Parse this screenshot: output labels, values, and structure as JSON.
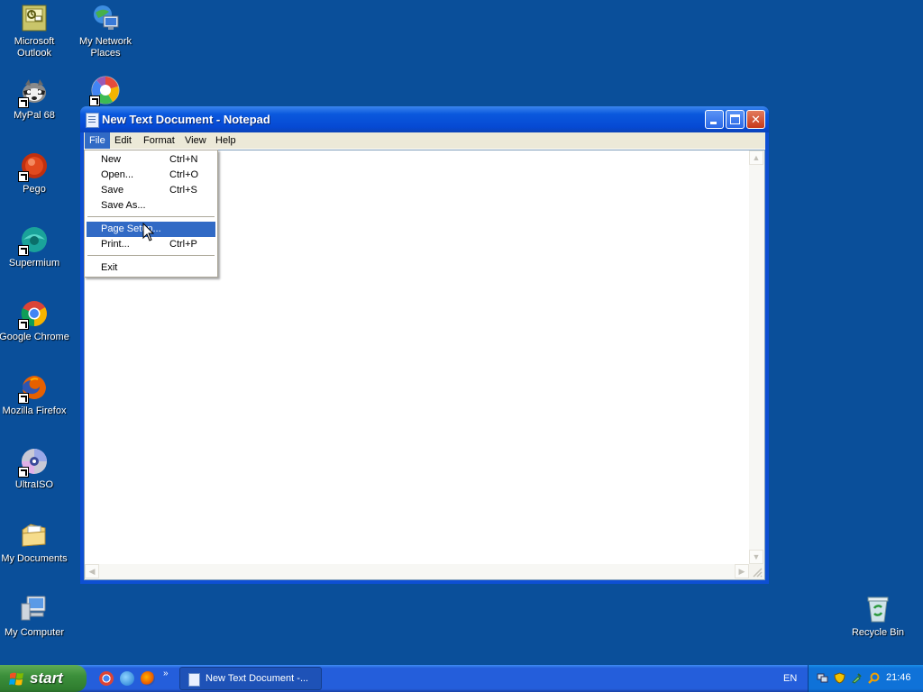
{
  "desktop": {
    "icons": [
      {
        "label": "Microsoft Outlook",
        "icon": "outlook-icon"
      },
      {
        "label": "My Network Places",
        "icon": "network-places-icon"
      },
      {
        "label": "MyPal 68",
        "icon": "mypal-icon"
      },
      {
        "label": "Pego",
        "icon": "pego-icon"
      },
      {
        "label": "Supermium",
        "icon": "supermium-icon"
      },
      {
        "label": "Google Chrome",
        "icon": "chrome-icon"
      },
      {
        "label": "Mozilla Firefox",
        "icon": "firefox-icon"
      },
      {
        "label": "UltraISO",
        "icon": "ultraiso-icon"
      },
      {
        "label": "My Documents",
        "icon": "my-documents-icon"
      },
      {
        "label": "My Computer",
        "icon": "my-computer-icon"
      },
      {
        "label": "Recycle Bin",
        "icon": "recycle-bin-icon"
      }
    ],
    "background_color": "#0a4f9a"
  },
  "window": {
    "title": "New Text Document - Notepad",
    "menu": [
      "File",
      "Edit",
      "Format",
      "View",
      "Help"
    ],
    "active_menu": "File",
    "editor_text": ""
  },
  "file_menu": {
    "items": [
      {
        "label": "New",
        "shortcut": "Ctrl+N"
      },
      {
        "label": "Open...",
        "shortcut": "Ctrl+O"
      },
      {
        "label": "Save",
        "shortcut": "Ctrl+S"
      },
      {
        "label": "Save As...",
        "shortcut": ""
      },
      {
        "label": "Page Setup...",
        "shortcut": "",
        "highlighted": true
      },
      {
        "label": "Print...",
        "shortcut": "Ctrl+P"
      },
      {
        "label": "Exit",
        "shortcut": ""
      }
    ],
    "highlight_color": "#316ac5"
  },
  "taskbar": {
    "start_label": "start",
    "task_button_label": "New Text Document -...",
    "language": "EN",
    "clock": "21:46",
    "more_glyph": "»"
  }
}
